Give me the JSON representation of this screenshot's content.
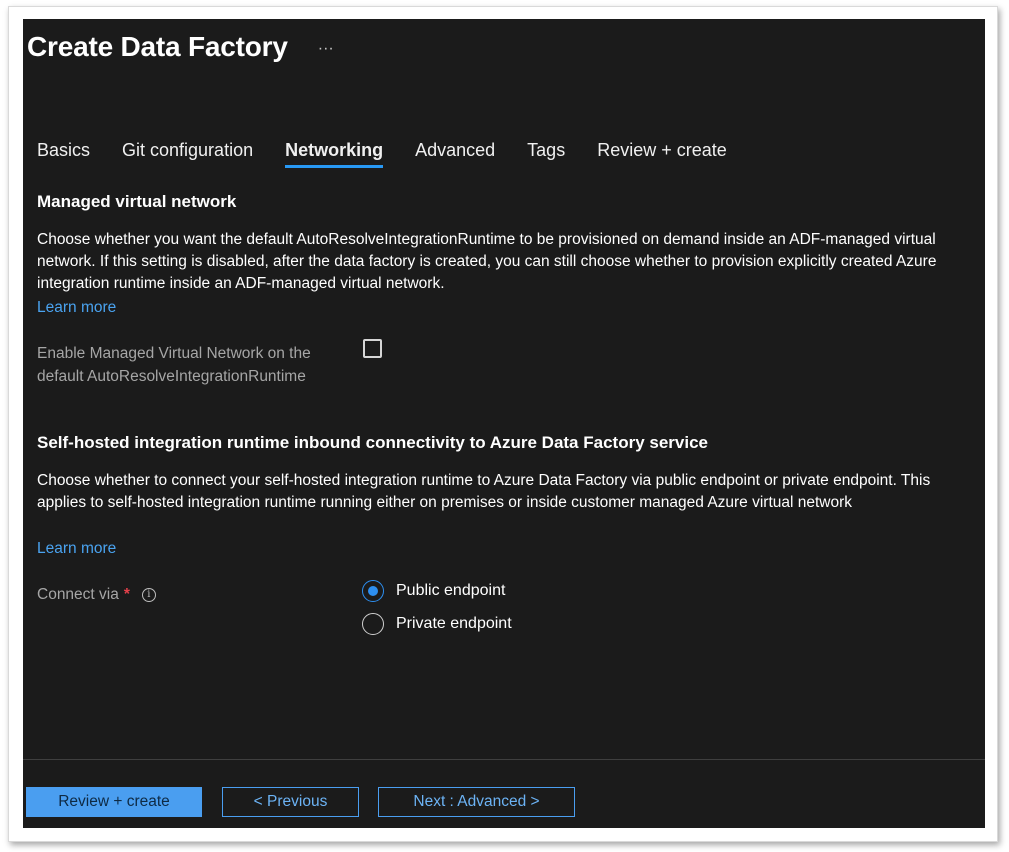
{
  "header": {
    "title": "Create Data Factory",
    "more_label": "···"
  },
  "tabs": [
    {
      "label": "Basics",
      "active": false
    },
    {
      "label": "Git configuration",
      "active": false
    },
    {
      "label": "Networking",
      "active": true
    },
    {
      "label": "Advanced",
      "active": false
    },
    {
      "label": "Tags",
      "active": false
    },
    {
      "label": "Review + create",
      "active": false
    }
  ],
  "managed_vnet": {
    "heading": "Managed virtual network",
    "description": "Choose whether you want the default AutoResolveIntegrationRuntime to be provisioned on demand inside an ADF-managed virtual network. If this setting is disabled, after the data factory is created, you can still choose whether to provision explicitly created Azure integration runtime inside an ADF-managed virtual network.",
    "learn_more": "Learn more",
    "enable_label": "Enable Managed Virtual Network on the default AutoResolveIntegrationRuntime",
    "enable_checked": false
  },
  "shir": {
    "heading": "Self-hosted integration runtime inbound connectivity to Azure Data Factory service",
    "description": "Choose whether to connect your self-hosted integration runtime to Azure Data Factory via public endpoint or private endpoint. This applies to self-hosted integration runtime running either on premises or inside customer managed Azure virtual network",
    "learn_more": "Learn more",
    "connect_label": "Connect via",
    "required_mark": "*",
    "info_icon": "i",
    "options": [
      {
        "label": "Public endpoint",
        "selected": true
      },
      {
        "label": "Private endpoint",
        "selected": false
      }
    ]
  },
  "footer": {
    "review_create": "Review + create",
    "previous": "< Previous",
    "next": "Next : Advanced >"
  },
  "colors": {
    "panel_bg": "#1b1b1b",
    "accent": "#2899f5",
    "link": "#4aa3f0",
    "required": "#e3404a"
  }
}
